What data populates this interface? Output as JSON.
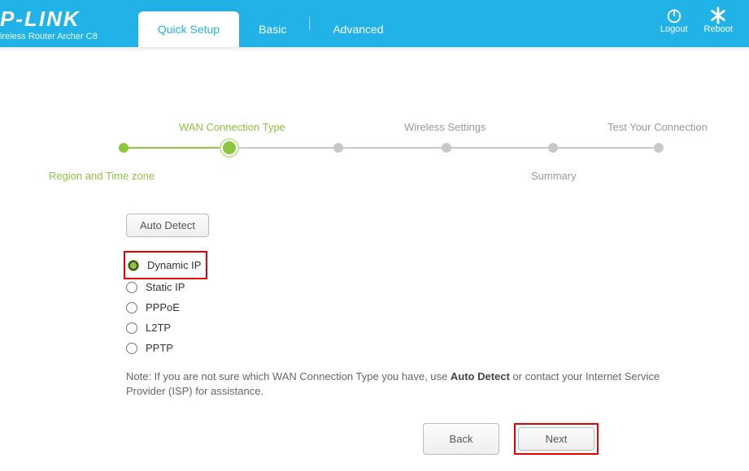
{
  "brand": "P-LINK",
  "device": "ireless Router Archer C8",
  "nav": {
    "quick_setup": "Quick Setup",
    "basic": "Basic",
    "advanced": "Advanced"
  },
  "header_actions": {
    "logout": "Logout",
    "reboot": "Reboot"
  },
  "stepper": {
    "region": "Region and Time zone",
    "wan": "WAN Connection Type",
    "wireless": "Wireless Settings",
    "summary": "Summary",
    "test": "Test Your Connection"
  },
  "buttons": {
    "auto_detect": "Auto Detect",
    "back": "Back",
    "next": "Next"
  },
  "wan_options": {
    "dynamic": "Dynamic IP",
    "static": "Static IP",
    "pppoe": "PPPoE",
    "l2tp": "L2TP",
    "pptp": "PPTP"
  },
  "note_prefix": "Note: If you are not sure which WAN Connection Type you have, use ",
  "note_bold": "Auto Detect",
  "note_suffix": " or contact your Internet Service Provider (ISP) for assistance."
}
